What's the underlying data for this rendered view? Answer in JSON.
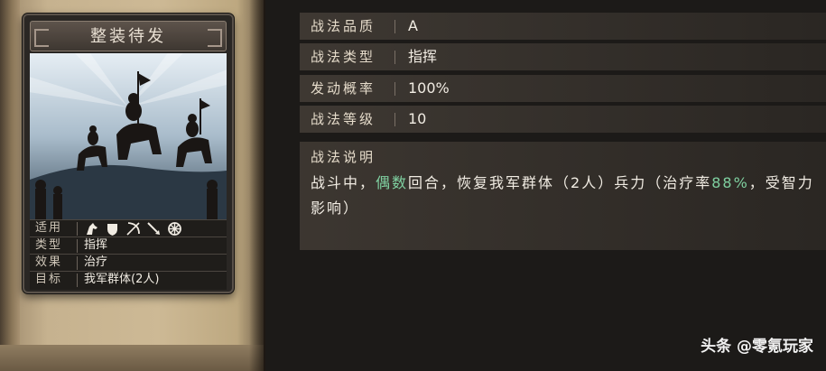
{
  "card": {
    "title": "整装待发",
    "rows": {
      "applicable_label": "适用",
      "type_label": "类型",
      "type_value": "指挥",
      "effect_label": "效果",
      "effect_value": "治疗",
      "target_label": "目标",
      "target_value": "我军群体(2人)"
    },
    "troop_icons": [
      "cavalry-icon",
      "shield-icon",
      "bow-icon",
      "spear-icon",
      "wheel-icon"
    ]
  },
  "stats": [
    {
      "label": "战法品质",
      "value": "A"
    },
    {
      "label": "战法类型",
      "value": "指挥"
    },
    {
      "label": "发动概率",
      "value": "100%"
    },
    {
      "label": "战法等级",
      "value": "10"
    }
  ],
  "description": {
    "heading": "战法说明",
    "part1": "战斗中，",
    "hl1": "偶数",
    "part2": "回合，恢复我军群体（2人）兵力（治疗率",
    "hl2": "88%",
    "part3": "，受智力影响）"
  },
  "colors": {
    "highlight": "#7fd0a0",
    "background": "#1c1a18"
  },
  "watermark": "头条 @零氪玩家"
}
